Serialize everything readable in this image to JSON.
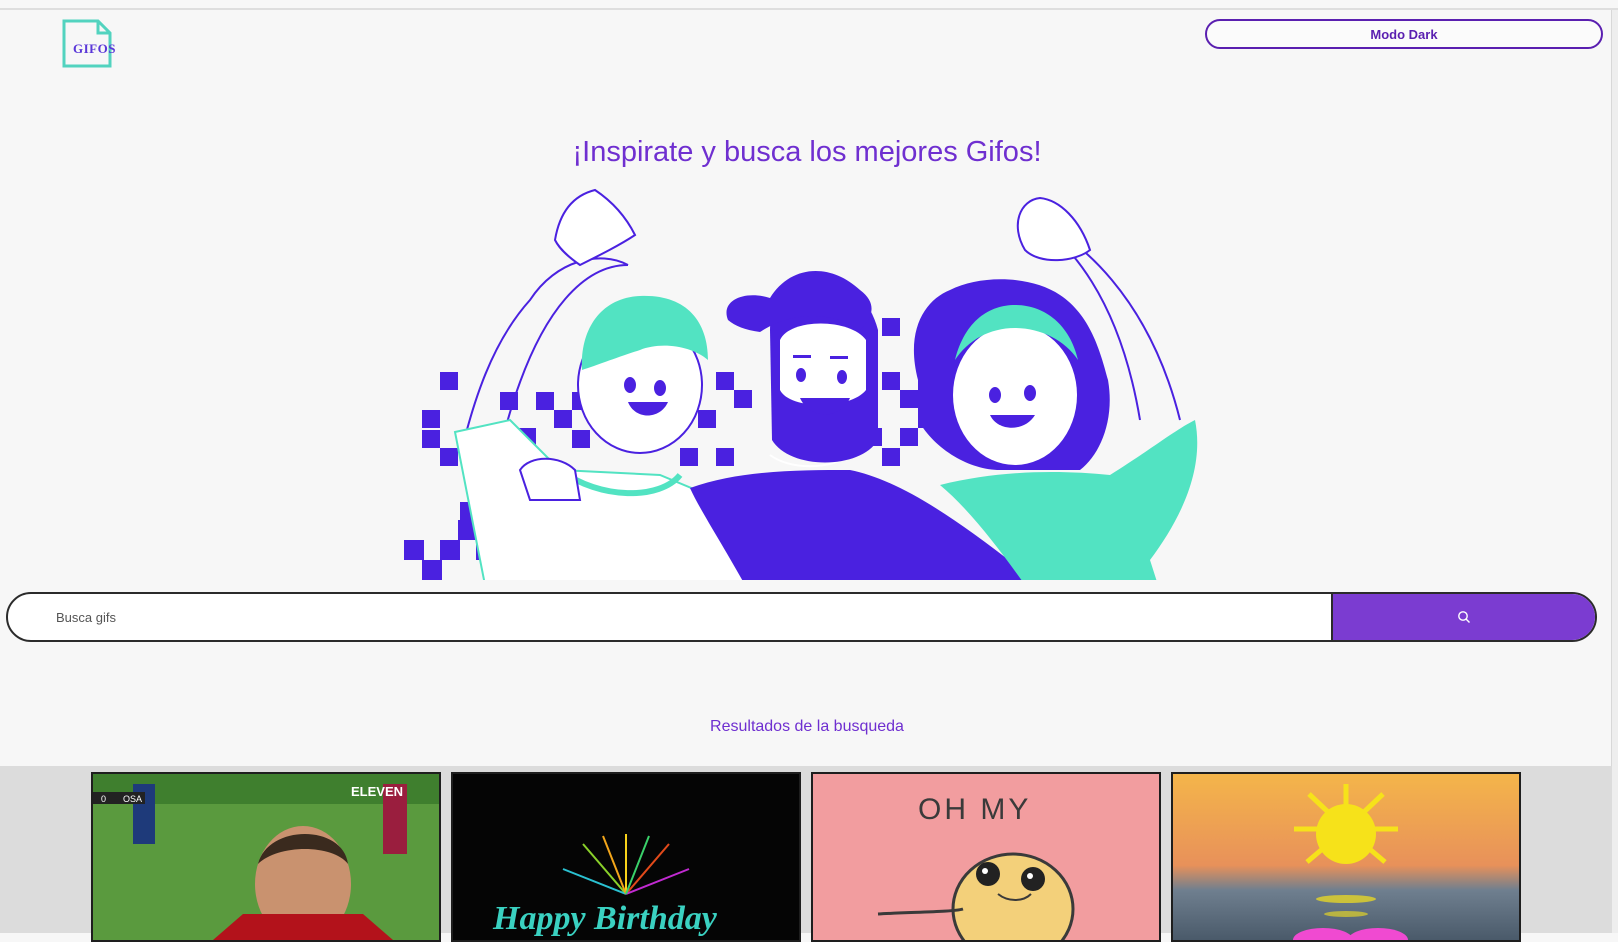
{
  "header": {
    "logo_text": "GIFOS",
    "mode_button_label": "Modo Dark"
  },
  "hero": {
    "title": "¡Inspirate y busca los mejores Gifos!"
  },
  "search": {
    "placeholder": "Busca gifs"
  },
  "results": {
    "label": "Resultados de la busqueda"
  },
  "gifs": [
    {
      "overlay_text": "ELEVEN",
      "score_text": "0",
      "team_text": "OSA"
    },
    {
      "text": "Happy Birthday"
    },
    {
      "text": "OH MY"
    },
    {
      "text": ""
    }
  ],
  "colors": {
    "accent": "#7b3cd1",
    "brand_purple": "#5a1fb0",
    "teal": "#52e3c2",
    "indigo": "#4a21e0"
  }
}
